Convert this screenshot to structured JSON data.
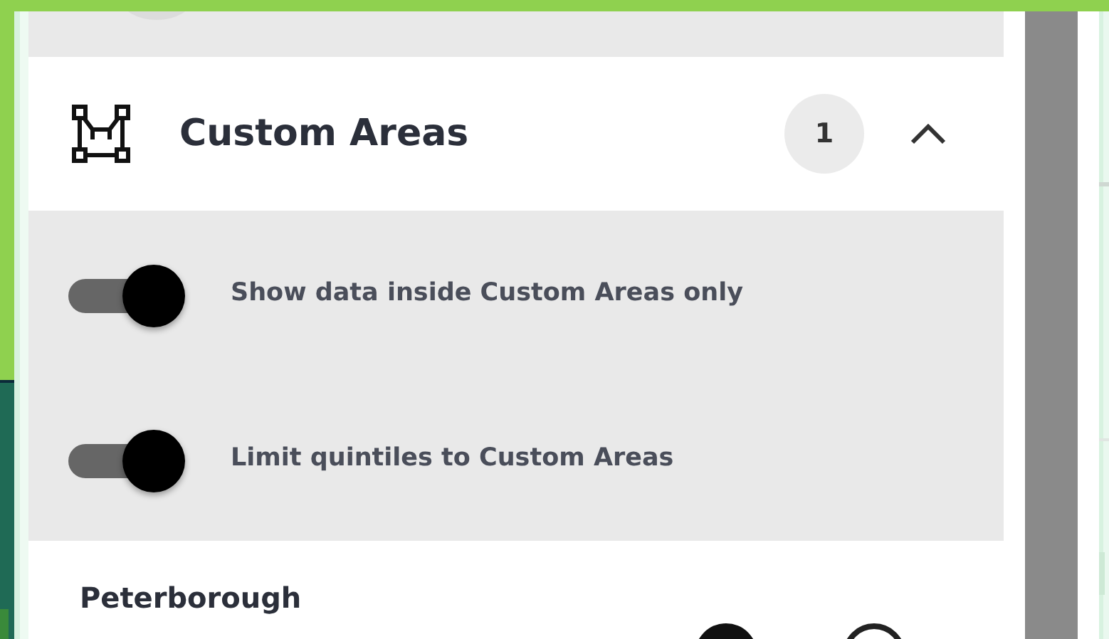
{
  "section": {
    "title": "Custom Areas",
    "count": "1",
    "expanded": true
  },
  "toggles": [
    {
      "label": "Show data inside Custom Areas only",
      "on": true
    },
    {
      "label": "Limit quintiles to Custom Areas",
      "on": true
    }
  ],
  "next_section": {
    "title": "Peterborough"
  }
}
